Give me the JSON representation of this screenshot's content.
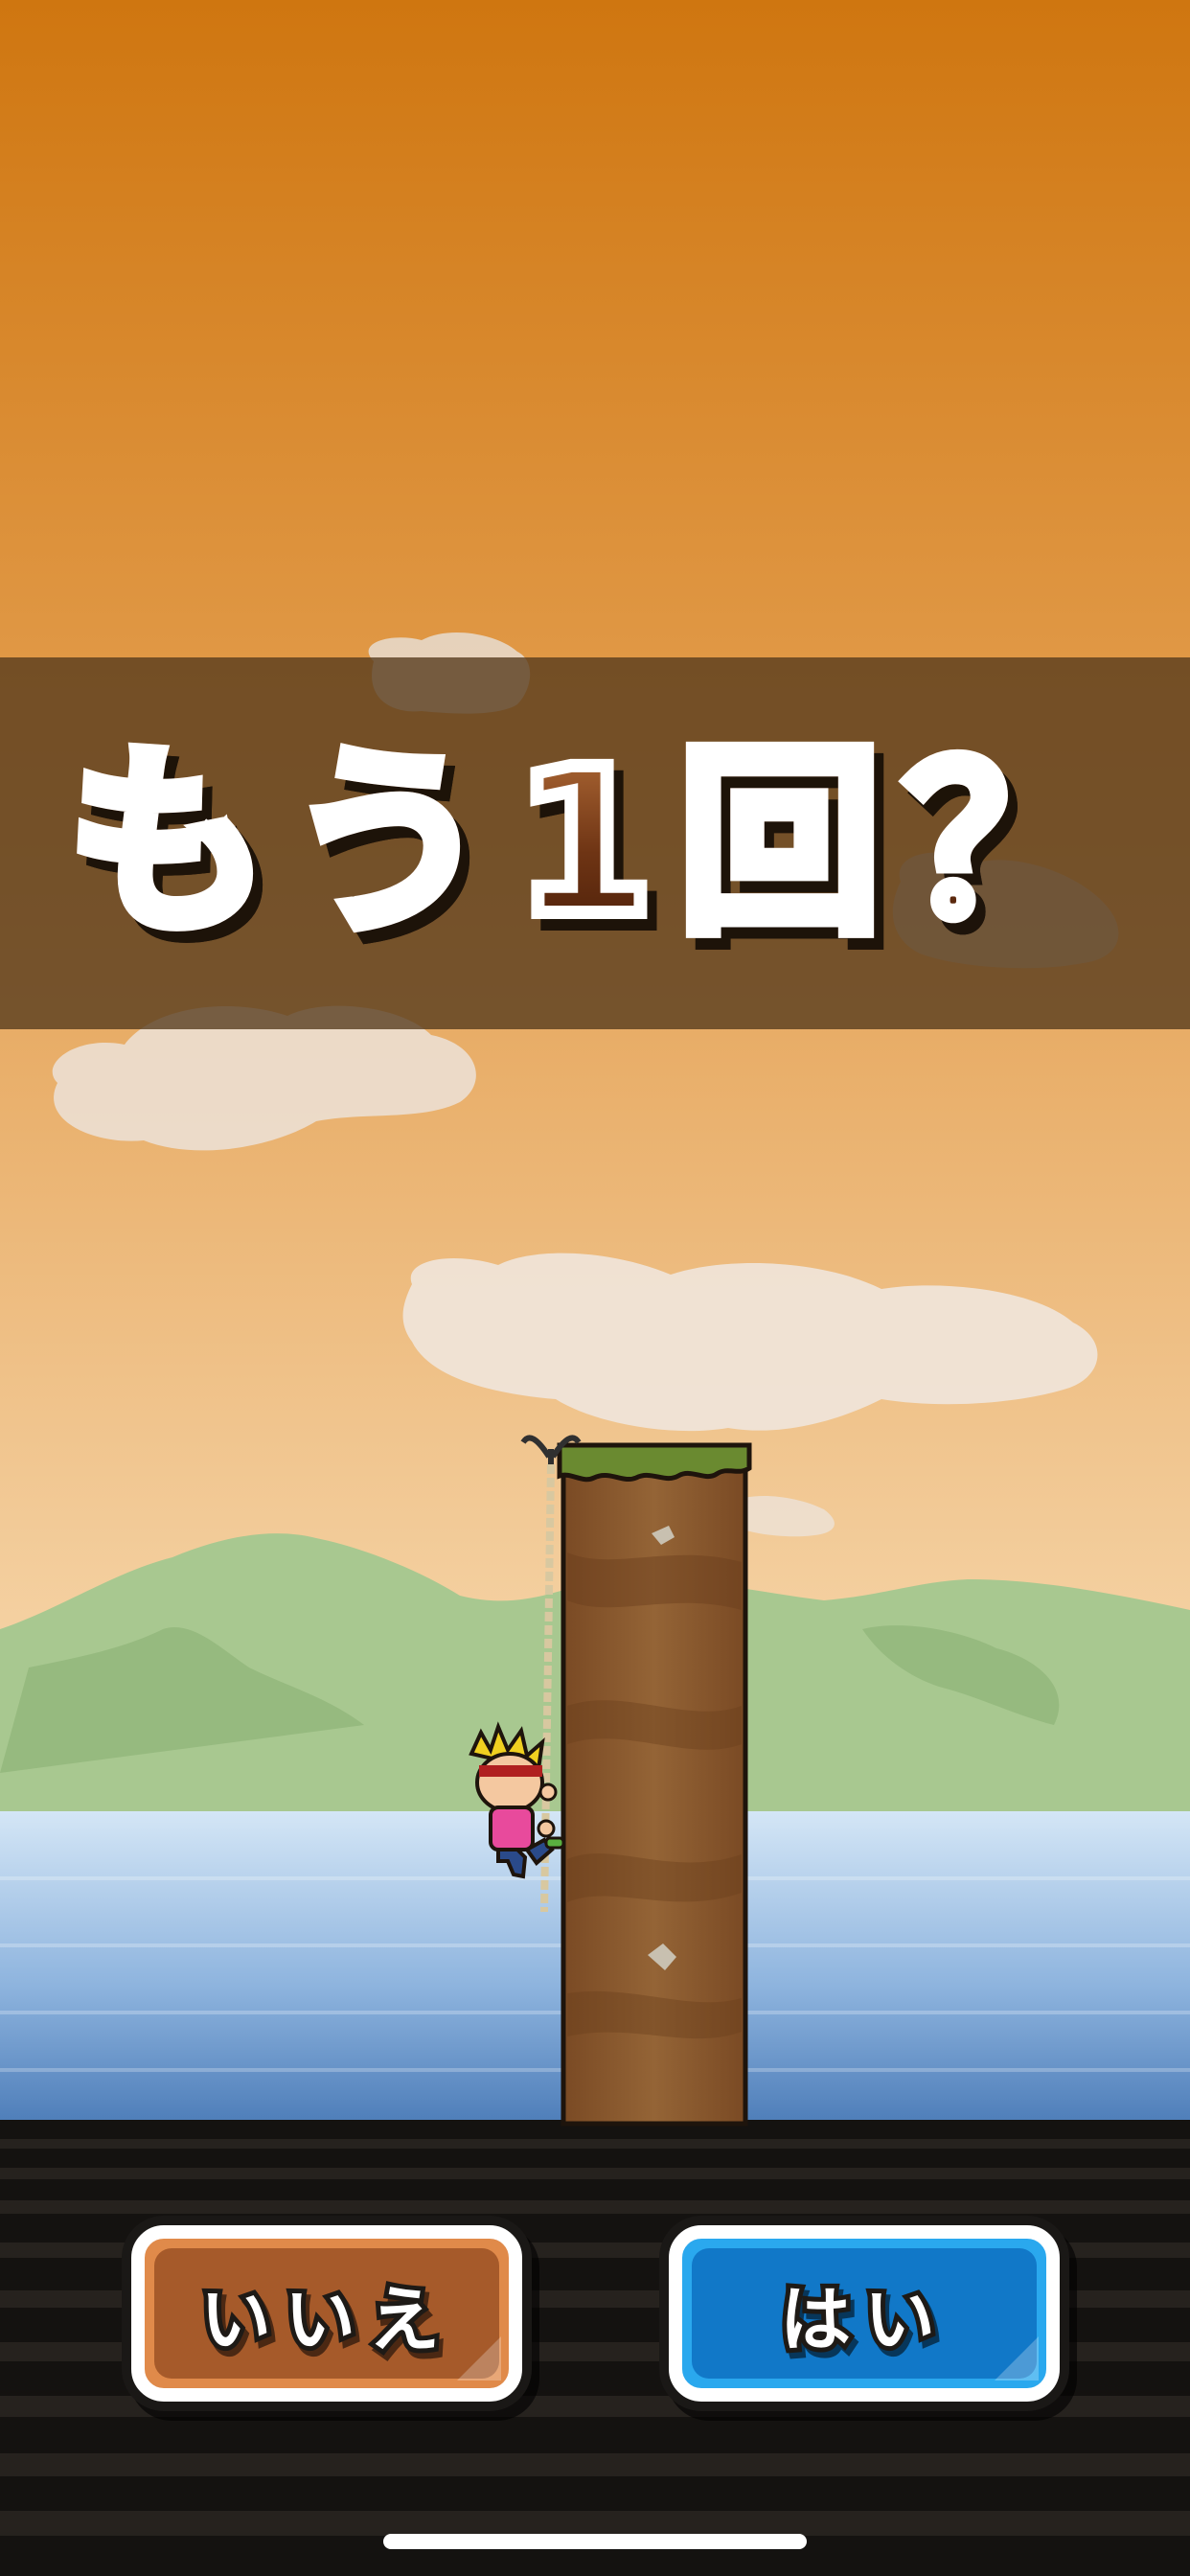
{
  "dialog": {
    "title": "もう1回？"
  },
  "buttons": {
    "no_label": "いいえ",
    "yes_label": "はい"
  },
  "colors": {
    "sky_top": "#cf7610",
    "sky_bottom": "#f8dcb4",
    "banner": "#543a1c",
    "no_button": "#e08a4a",
    "yes_button": "#1178c8",
    "hills": "#a8c890",
    "water": "#9cc0e4",
    "pillar": "#8a5a30"
  },
  "icons": {
    "player": "climber-character-icon",
    "hook": "grappling-hook-icon"
  }
}
